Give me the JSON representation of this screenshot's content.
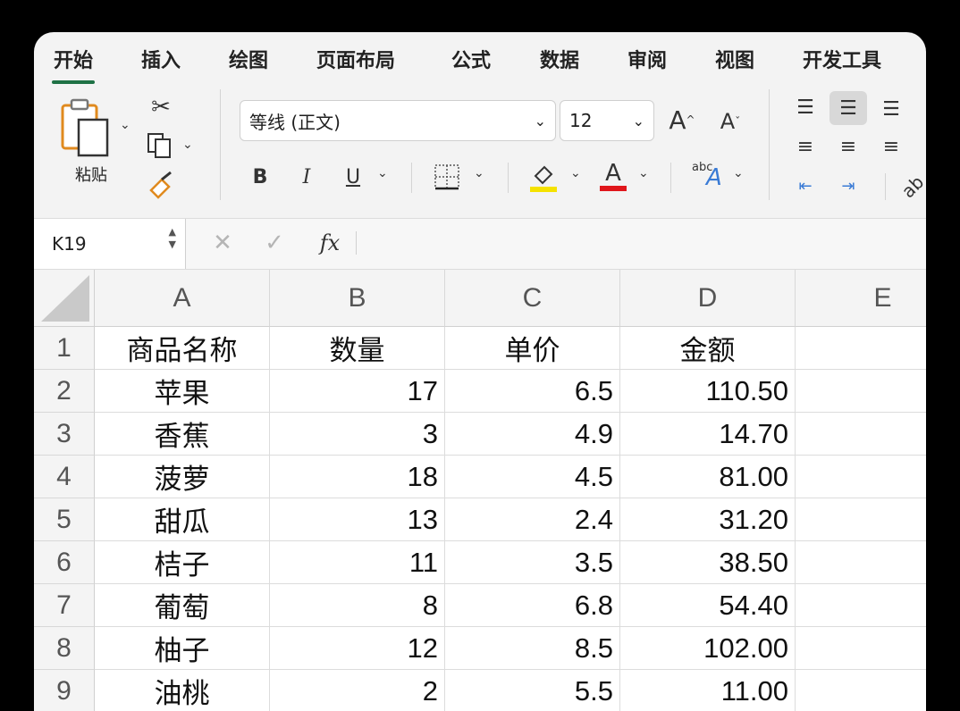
{
  "tabs": [
    {
      "label": "开始",
      "active": true
    },
    {
      "label": "插入"
    },
    {
      "label": "绘图"
    },
    {
      "label": "页面布局"
    },
    {
      "label": "公式"
    },
    {
      "label": "数据"
    },
    {
      "label": "审阅"
    },
    {
      "label": "视图"
    },
    {
      "label": "开发工具"
    }
  ],
  "ribbon": {
    "paste_label": "粘贴",
    "font_name": "等线 (正文)",
    "font_size": "12",
    "grow_font": "A",
    "shrink_font": "A",
    "bold": "B",
    "italic": "I",
    "underline": "U",
    "font_color_letter": "A",
    "fill_color": "#f5e200",
    "font_color": "#e0161b",
    "text_style_sup": "abc",
    "text_style_letter": "A"
  },
  "formula_bar": {
    "name_box": "K19",
    "fx": "fx",
    "formula": ""
  },
  "sheet": {
    "columns": [
      "A",
      "B",
      "C",
      "D",
      "E"
    ],
    "rows": [
      {
        "num": "1",
        "cells": [
          "商品名称",
          "数量",
          "单价",
          "金额",
          ""
        ]
      },
      {
        "num": "2",
        "cells": [
          "苹果",
          "17",
          "6.5",
          "110.50",
          ""
        ]
      },
      {
        "num": "3",
        "cells": [
          "香蕉",
          "3",
          "4.9",
          "14.70",
          ""
        ]
      },
      {
        "num": "4",
        "cells": [
          "菠萝",
          "18",
          "4.5",
          "81.00",
          ""
        ]
      },
      {
        "num": "5",
        "cells": [
          "甜瓜",
          "13",
          "2.4",
          "31.20",
          ""
        ]
      },
      {
        "num": "6",
        "cells": [
          "桔子",
          "11",
          "3.5",
          "38.50",
          ""
        ]
      },
      {
        "num": "7",
        "cells": [
          "葡萄",
          "8",
          "6.8",
          "54.40",
          ""
        ]
      },
      {
        "num": "8",
        "cells": [
          "柚子",
          "12",
          "8.5",
          "102.00",
          ""
        ]
      },
      {
        "num": "9",
        "cells": [
          "油桃",
          "2",
          "5.5",
          "11.00",
          ""
        ]
      }
    ]
  },
  "colors": {
    "accent": "#1e7145"
  }
}
